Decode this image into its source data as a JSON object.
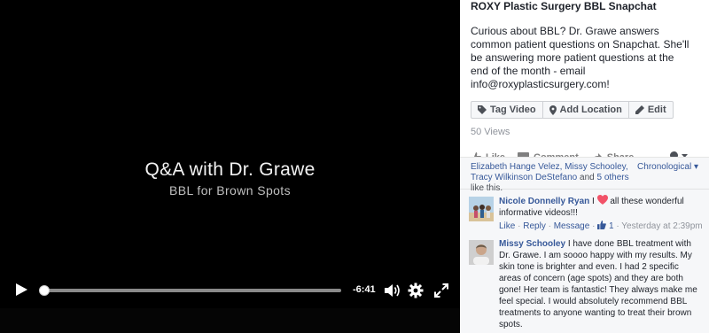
{
  "video": {
    "title": "Q&A with Dr. Grawe",
    "subtitle": "BBL for Brown Spots",
    "time_remaining": "-6:41",
    "progress": 0.0
  },
  "post": {
    "title": "ROXY Plastic Surgery BBL Snapchat",
    "description": "Curious about BBL? Dr. Grawe answers common patient questions on Snapchat. She'll be answering more patient questions at the end of the month - email info@roxyplasticsurgery.com!",
    "buttons": {
      "tag_video": "Tag Video",
      "add_location": "Add Location",
      "edit": "Edit"
    },
    "views": "50 Views",
    "actions": {
      "like": "Like",
      "comment": "Comment",
      "share": "Share"
    }
  },
  "likes": {
    "names": "Elizabeth Hange Velez, Missy Schooley, Tracy Wilkinson DeStefano",
    "and_text": "and",
    "others": "5 others",
    "suffix": "like this.",
    "sort_label": "Chronological"
  },
  "comments": [
    {
      "author": "Nicole Donnelly Ryan",
      "text_before": "I",
      "text_after": "all these wonderful informative videos!!!",
      "like": "Like",
      "reply": "Reply",
      "message": "Message",
      "like_count": "1",
      "timestamp": "Yesterday at 2:39pm"
    },
    {
      "author": "Missy Schooley",
      "text": "I have done BBL treatment with Dr. Grawe. I am soooo happy with my results. My skin tone is brighter and even. I had 2 specific areas of concern (age spots) and they are both gone! Her team is fantastic! They always make me feel special. I would absolutely recommend BBL treatments to anyone wanting to treat their brown spots."
    }
  ],
  "colors": {
    "link": "#365899",
    "heart": "#f25268",
    "panel_bg": "#ffffff",
    "comments_bg": "#f6f7f9"
  }
}
